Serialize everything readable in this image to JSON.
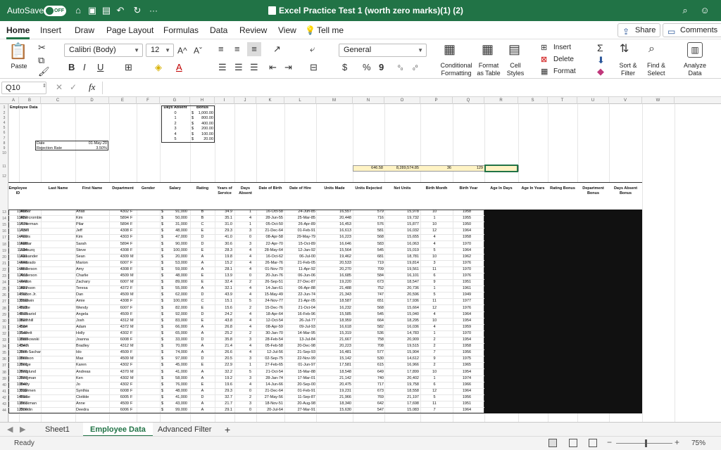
{
  "titlebar": {
    "autosave_label": "AutoSave",
    "autosave_state": "OFF",
    "doc_title": "Excel Practice Test 1 (worth zero marks)(1) (2)",
    "more": "···"
  },
  "menu": {
    "tabs": [
      "Home",
      "Insert",
      "Draw",
      "Page Layout",
      "Formulas",
      "Data",
      "Review",
      "View"
    ],
    "tell_me": "Tell me",
    "share": "Share",
    "comments": "Comments"
  },
  "ribbon": {
    "paste": "Paste",
    "font_name": "Calibri (Body)",
    "font_size": "12",
    "number_format": "General",
    "bold": "B",
    "italic": "I",
    "underline": "U",
    "insert": "Insert",
    "delete": "Delete",
    "format": "Format",
    "cond_format": "Conditional\nFormatting",
    "format_table": "Format\nas Table",
    "cell_styles": "Cell\nStyles",
    "sort_filter": "Sort &\nFilter",
    "find_select": "Find &\nSelect",
    "analyze": "Analyze\nData",
    "currency": "$",
    "percent": "%",
    "comma": "9",
    "fx": "fx"
  },
  "formula_bar": {
    "name_box": "Q10",
    "formula": ""
  },
  "columns": [
    "A",
    "B",
    "C",
    "D",
    "E",
    "F",
    "G",
    "H",
    "I",
    "J",
    "K",
    "L",
    "M",
    "N",
    "O",
    "P",
    "Q",
    "R",
    "S",
    "T",
    "U",
    "V",
    "W"
  ],
  "top": {
    "employee_data": "Employee Data",
    "days_absent_hdr": "Days Absent",
    "bonus_hdr": "Bonus",
    "bonus_rows": [
      [
        "0",
        "$",
        "1,000.00"
      ],
      [
        "1",
        "$",
        "800.00"
      ],
      [
        "2",
        "$",
        "400.00"
      ],
      [
        "3",
        "$",
        "200.00"
      ],
      [
        "4",
        "$",
        "100.00"
      ],
      [
        "5",
        "$",
        "20.00"
      ]
    ],
    "date_label": "Date",
    "date_value": "01-May-20",
    "rej_label": "Rejection Rate",
    "rej_value": "3.50%",
    "totals": [
      "646.58",
      "8,289,574.85",
      "36",
      "129"
    ]
  },
  "headers": [
    "Employee ID",
    "Last Name",
    "First Name",
    "Department",
    "Gender",
    "Salary",
    "Rating",
    "Years of Service",
    "Days Absent",
    "Date of Birth",
    "Date of Hire",
    "Units Made",
    "Units Rejected",
    "Net Units",
    "Birth Month",
    "Birth Year",
    "Age In Days",
    "Age In Years",
    "Rating Bonus",
    "Department Bonus",
    "Days Absent Bonus"
  ],
  "rows": [
    [
      "13816",
      "Abbar",
      "Anas",
      "4302",
      "F",
      "$",
      "91,000",
      "B",
      "34.9",
      "1",
      "16-Oct-58",
      "24-Jun-85",
      "16,557",
      "579",
      "15,978",
      "10",
      "1958"
    ],
    [
      "13832",
      "Abercrombie",
      "Kim",
      "5894",
      "F",
      "$",
      "50,000",
      "B",
      "35.1",
      "4",
      "28-Jun-55",
      "25-Mar-85",
      "20,448",
      "716",
      "19,732",
      "1",
      "1955"
    ],
    [
      "10774",
      "Ackerman",
      "Pilar",
      "5894",
      "F",
      "$",
      "31,000",
      "C",
      "31.0",
      "1",
      "05-Oct-50",
      "26-Apr-89",
      "16,453",
      "576",
      "15,877",
      "10",
      "1950"
    ],
    [
      "11737",
      "Adell",
      "Jeff",
      "4308",
      "F",
      "$",
      "48,000",
      "E",
      "29.3",
      "3",
      "21-Dec-64",
      "01-Feb-91",
      "16,613",
      "581",
      "16,032",
      "12",
      "1964"
    ],
    [
      "14470",
      "Akers",
      "Kim",
      "4303",
      "F",
      "$",
      "47,000",
      "D",
      "41.0",
      "0",
      "08-Apr-58",
      "29-May-79",
      "16,223",
      "568",
      "15,655",
      "4",
      "1958"
    ],
    [
      "10598",
      "Akhtar",
      "Sarah",
      "5894",
      "F",
      "$",
      "90,000",
      "D",
      "30.6",
      "3",
      "22-Apr-70",
      "15-Oct-89",
      "16,646",
      "583",
      "16,063",
      "4",
      "1970"
    ],
    [
      "11194",
      "Albouzq",
      "Steve",
      "4308",
      "F",
      "$",
      "100,000",
      "E",
      "28.3",
      "4",
      "28-May-64",
      "12-Jan-92",
      "15,564",
      "545",
      "15,019",
      "5",
      "1964"
    ],
    [
      "11631",
      "Alexander",
      "Sean",
      "4309",
      "M",
      "$",
      "20,000",
      "A",
      "19.8",
      "4",
      "16-Oct-62",
      "06-Jul-00",
      "19,462",
      "681",
      "18,781",
      "10",
      "1962"
    ],
    [
      "14548",
      "Alvarado",
      "Marion",
      "6007",
      "F",
      "$",
      "53,000",
      "A",
      "15.2",
      "4",
      "26-Mar-76",
      "21-Feb-05",
      "20,533",
      "719",
      "19,814",
      "3",
      "1976"
    ],
    [
      "14957",
      "Anderson",
      "Amy",
      "4308",
      "F",
      "$",
      "59,000",
      "A",
      "28.1",
      "4",
      "01-Nov-70",
      "11-Apr-92",
      "20,270",
      "709",
      "19,561",
      "11",
      "1970"
    ],
    [
      "12011",
      "Anderson",
      "Charlie",
      "4509",
      "M",
      "$",
      "48,000",
      "E",
      "13.9",
      "0",
      "20-Jun-76",
      "06-Jun-06",
      "16,685",
      "584",
      "16,101",
      "6",
      "1976"
    ],
    [
      "14048",
      "Anson",
      "Zachary",
      "6007",
      "M",
      "$",
      "89,000",
      "E",
      "32.4",
      "2",
      "26-Sep-51",
      "27-Dec-87",
      "19,220",
      "673",
      "18,547",
      "9",
      "1951"
    ],
    [
      "13827",
      "Atkinson",
      "Teresa",
      "4372",
      "F",
      "$",
      "55,000",
      "A",
      "32.1",
      "4",
      "14-Jan-61",
      "06-Apr-88",
      "21,488",
      "752",
      "20,736",
      "1",
      "1961"
    ],
    [
      "14765",
      "Bacon Jr.",
      "Dan",
      "4509",
      "M",
      "$",
      "62,000",
      "D",
      "43.9",
      "4",
      "15-May-49",
      "22-Jun-74",
      "21,343",
      "747",
      "20,596",
      "5",
      "1949"
    ],
    [
      "13250",
      "Baldwin",
      "Amie",
      "4308",
      "F",
      "$",
      "100,000",
      "C",
      "15.1",
      "5",
      "24-Nov-77",
      "21-Apr-05",
      "18,587",
      "651",
      "17,936",
      "11",
      "1977"
    ],
    [
      "14023",
      "Balke",
      "Wendy",
      "6007",
      "F",
      "$",
      "82,000",
      "E",
      "15.6",
      "2",
      "15-Dec-76",
      "21-Oct-04",
      "16,232",
      "568",
      "15,664",
      "12",
      "1976"
    ],
    [
      "14075",
      "Barbariol",
      "Angela",
      "4509",
      "F",
      "$",
      "92,000",
      "D",
      "24.2",
      "4",
      "18-Apr-64",
      "16-Feb-96",
      "15,585",
      "545",
      "15,040",
      "4",
      "1964"
    ],
    [
      "10827",
      "Barnhill",
      "Josh",
      "4312",
      "M",
      "$",
      "83,000",
      "E",
      "43.8",
      "4",
      "12-Oct-54",
      "26-Jul-77",
      "18,959",
      "664",
      "18,295",
      "10",
      "1954"
    ],
    [
      "14584",
      "Barr",
      "Adam",
      "4372",
      "M",
      "$",
      "66,000",
      "A",
      "26.8",
      "4",
      "08-Apr-59",
      "09-Jul-93",
      "16,618",
      "582",
      "16,036",
      "4",
      "1959"
    ],
    [
      "10149",
      "Barrett",
      "Holly",
      "4302",
      "F",
      "$",
      "65,000",
      "A",
      "25.2",
      "2",
      "30-Jan-70",
      "14-Mar-95",
      "15,319",
      "536",
      "14,783",
      "1",
      "1970"
    ],
    [
      "11889",
      "Bartkowski",
      "Joanna",
      "6008",
      "F",
      "$",
      "33,000",
      "D",
      "35.8",
      "3",
      "28-Feb-54",
      "13-Jul-84",
      "21,667",
      "758",
      "20,909",
      "2",
      "1954"
    ],
    [
      "14347",
      "Beck",
      "Bradley",
      "4312",
      "M",
      "$",
      "70,000",
      "A",
      "21.4",
      "4",
      "05-Feb-58",
      "20-Dec-98",
      "20,223",
      "708",
      "19,515",
      "2",
      "1958"
    ],
    [
      "12005",
      "Ben-Sachar",
      "Ido",
      "4509",
      "F",
      "$",
      "74,000",
      "A",
      "26.6",
      "4",
      "12-Jul-56",
      "21-Sep-93",
      "16,481",
      "577",
      "15,904",
      "7",
      "1956"
    ],
    [
      "10069",
      "Benson",
      "Max",
      "4509",
      "M",
      "$",
      "97,000",
      "D",
      "20.5",
      "3",
      "02-Sep-75",
      "22-Nov-99",
      "15,142",
      "530",
      "14,612",
      "9",
      "1975"
    ],
    [
      "12001",
      "Berge",
      "Karen",
      "4302",
      "F",
      "$",
      "45,000",
      "E",
      "22.9",
      "1",
      "27-Feb-65",
      "01-Jun-97",
      "17,581",
      "615",
      "16,966",
      "2",
      "1965"
    ],
    [
      "12833",
      "Berglund",
      "Andreas",
      "4370",
      "M",
      "$",
      "41,000",
      "A",
      "32.2",
      "5",
      "21-Oct-54",
      "15-Mar-88",
      "18,548",
      "649",
      "17,899",
      "10",
      "1954"
    ],
    [
      "12037",
      "Bergman",
      "Ken",
      "4302",
      "M",
      "$",
      "58,000",
      "A",
      "19.2",
      "3",
      "28-Jan-74",
      "17-Mar-01",
      "21,142",
      "740",
      "20,402",
      "1",
      "1974"
    ],
    [
      "10040",
      "Berry",
      "Jo",
      "4302",
      "F",
      "$",
      "76,000",
      "E",
      "19.6",
      "4",
      "14-Jun-66",
      "20-Sep-00",
      "20,475",
      "717",
      "19,758",
      "6",
      "1966"
    ],
    [
      "13232",
      "Bidemen",
      "Synthia",
      "6008",
      "F",
      "$",
      "48,000",
      "A",
      "29.3",
      "0",
      "21-Dec-64",
      "01-Feb-91",
      "19,231",
      "673",
      "18,558",
      "12",
      "1964"
    ],
    [
      "14018",
      "Biese",
      "Clotilde",
      "6005",
      "F",
      "$",
      "41,000",
      "D",
      "32.7",
      "2",
      "27-May-56",
      "11-Sep-87",
      "21,966",
      "769",
      "21,197",
      "5",
      "1956"
    ],
    [
      "11061",
      "Bockman",
      "Anne",
      "4509",
      "F",
      "$",
      "43,000",
      "A",
      "21.7",
      "3",
      "18-Nov-51",
      "20-Aug-98",
      "18,340",
      "642",
      "17,698",
      "11",
      "1951"
    ],
    [
      "12200",
      "Boedin",
      "Deedra",
      "6006",
      "F",
      "$",
      "99,000",
      "A",
      "29.1",
      "0",
      "20-Jul-64",
      "27-Mar-91",
      "15,630",
      "547",
      "15,083",
      "7",
      "1964"
    ]
  ],
  "sheets": {
    "tabs": [
      "Sheet1",
      "Employee Data",
      "Advanced Filter"
    ],
    "add": "+"
  },
  "status": {
    "ready": "Ready",
    "zoom": "75%"
  }
}
